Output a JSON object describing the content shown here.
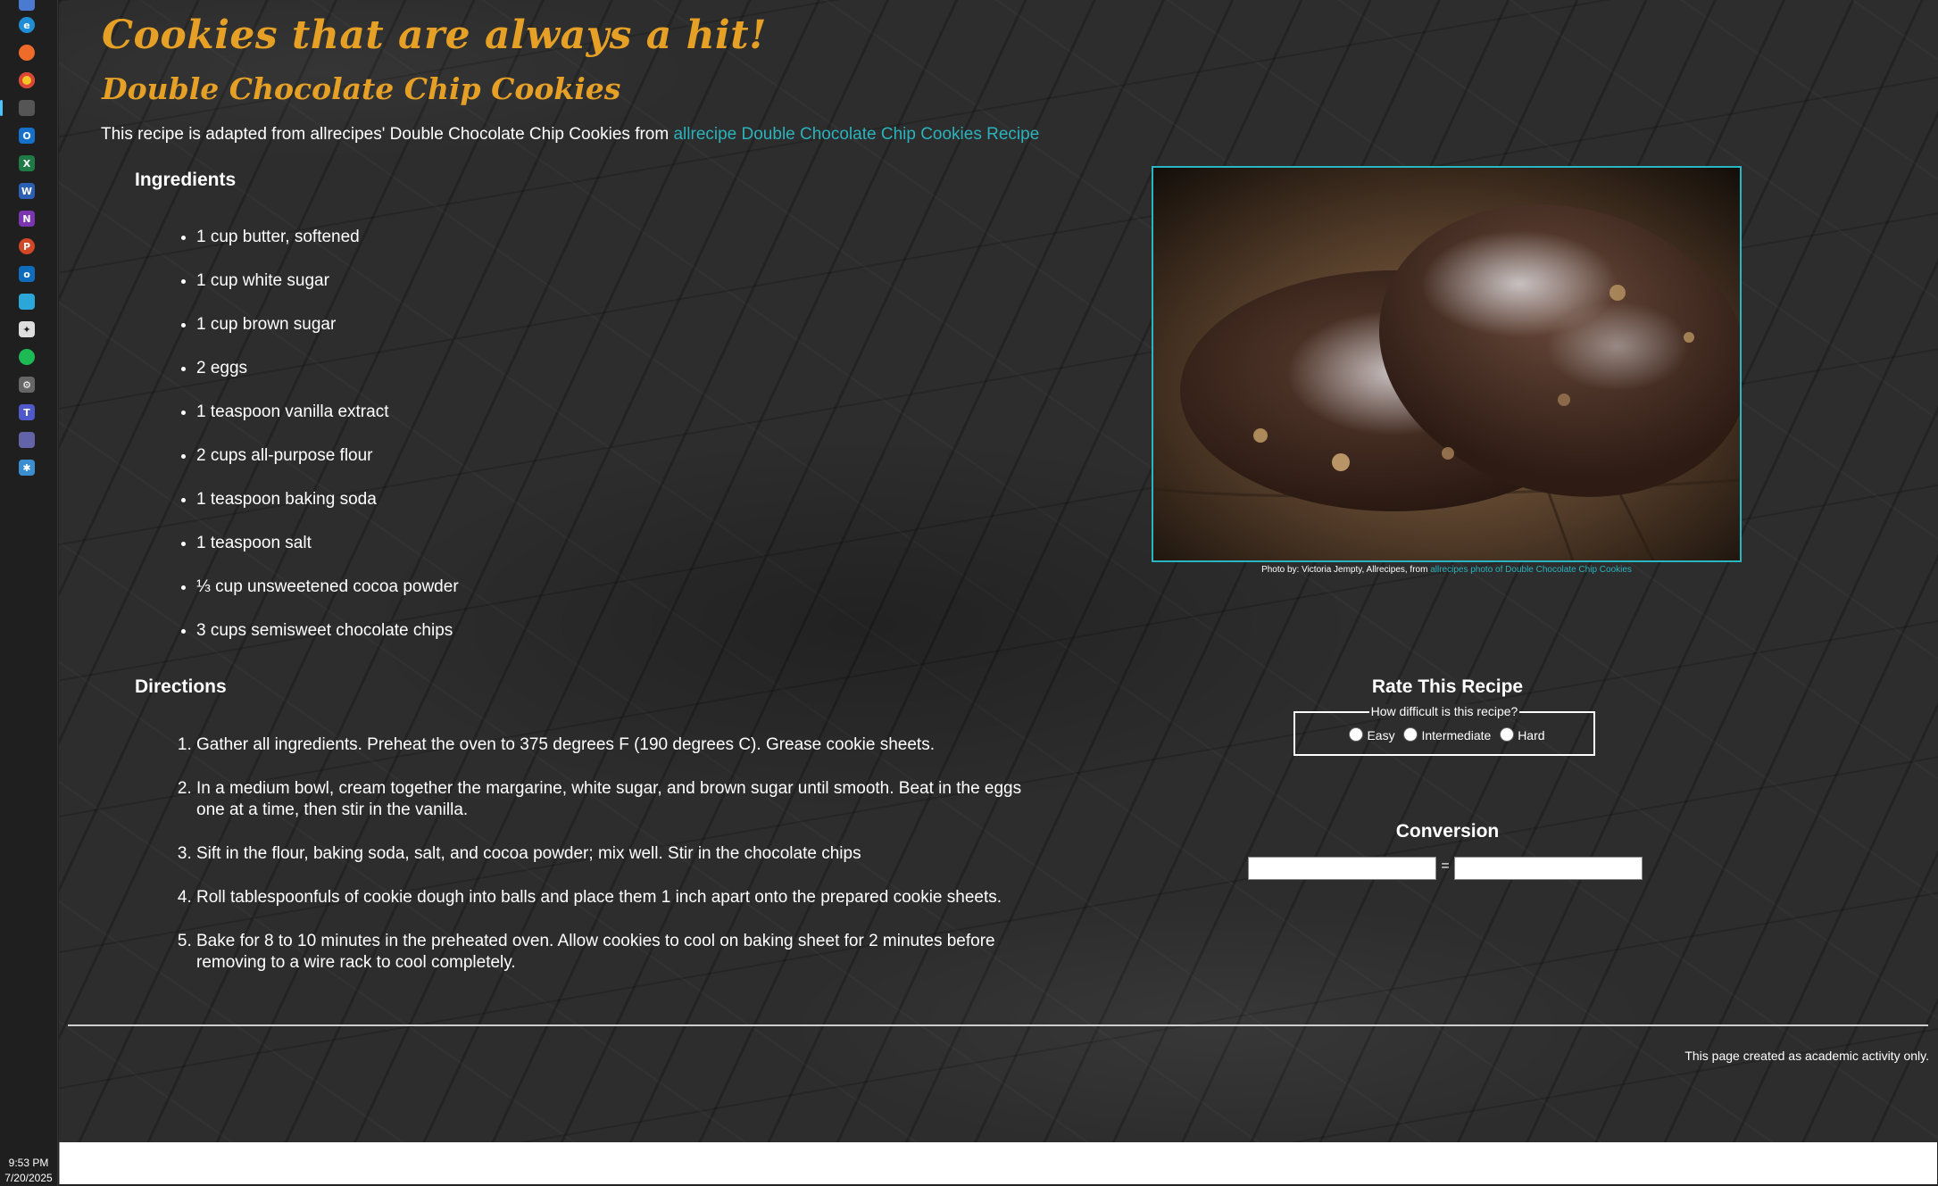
{
  "page": {
    "title": "Cookies that are always a hit!",
    "subtitle": "Double Chocolate Chip Cookies",
    "intro_text": "This recipe is adapted from allrecipes' Double Chocolate Chip Cookies from",
    "intro_link": "allrecipe Double Chocolate Chip Cookies Recipe"
  },
  "ingredients": {
    "heading": "Ingredients",
    "items": [
      "1 cup butter, softened",
      "1 cup white sugar",
      "1 cup brown sugar",
      "2 eggs",
      "1 teaspoon vanilla extract",
      "2 cups all-purpose flour",
      "1 teaspoon baking soda",
      "1 teaspoon salt",
      "⅓ cup unsweetened cocoa powder",
      "3 cups semisweet chocolate chips"
    ]
  },
  "directions": {
    "heading": "Directions",
    "steps": [
      "Gather all ingredients. Preheat the oven to 375 degrees F (190 degrees C). Grease cookie sheets.",
      "In a medium bowl, cream together the margarine, white sugar, and brown sugar until smooth. Beat in the eggs one at a time, then stir in the vanilla.",
      "Sift in the flour, baking soda, salt, and cocoa powder; mix well. Stir in the chocolate chips",
      "Roll tablespoonfuls of cookie dough into balls and place them 1 inch apart onto the prepared cookie sheets.",
      "Bake for 8 to 10 minutes in the preheated oven. Allow cookies to cool on baking sheet for 2 minutes before removing to a wire rack to cool completely."
    ]
  },
  "photo": {
    "caption_text": "Photo by: Victoria Jempty, Allrecipes, from",
    "caption_link": "allrecipes photo of Double Chocolate Chip Cookies"
  },
  "rating": {
    "heading": "Rate This Recipe",
    "legend": "How difficult is this recipe?",
    "options": [
      "Easy",
      "Intermediate",
      "Hard"
    ]
  },
  "conversion": {
    "heading": "Conversion",
    "equals": "=",
    "from_value": "",
    "to_value": ""
  },
  "footer": {
    "note": "This page created as academic activity only."
  },
  "taskbar": {
    "time": "9:53 PM",
    "date": "7/20/2025",
    "icons": [
      "app-icon",
      "edge-icon",
      "firefox-icon",
      "chrome-icon",
      "pinned-app-icon",
      "outlook-icon",
      "excel-icon",
      "word-icon",
      "onenote-icon",
      "powerpoint-icon",
      "outlook-classic-icon",
      "store-icon",
      "puzzle-icon",
      "spotify-icon",
      "settings-icon",
      "teams-icon",
      "teams-alt-icon",
      "visual-studio-icon"
    ]
  },
  "colors": {
    "heading": "#e6a026",
    "link": "#2ab3bd",
    "text": "#ffffff"
  }
}
